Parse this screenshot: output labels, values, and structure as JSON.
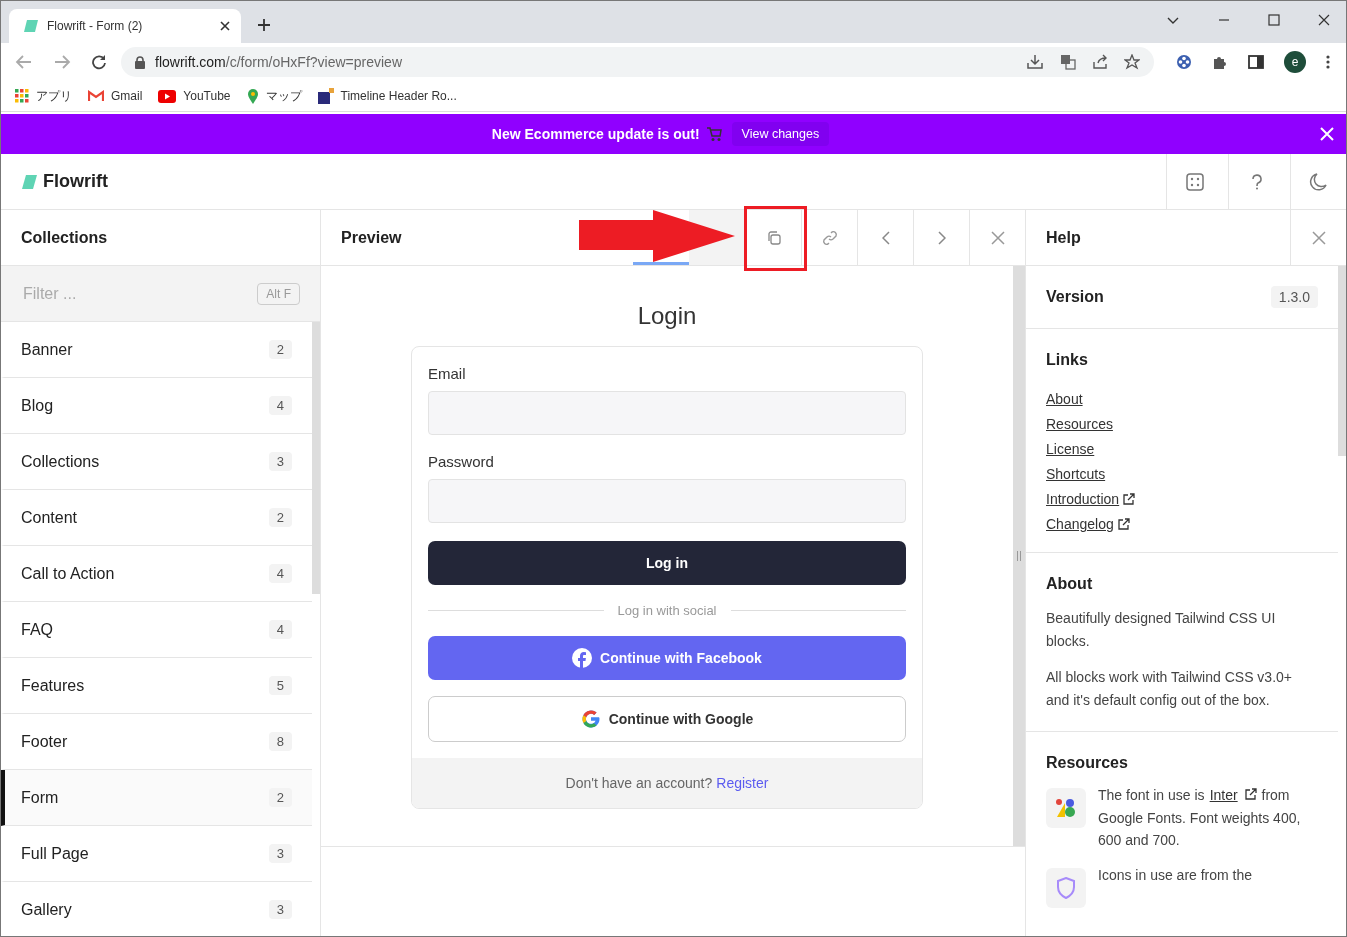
{
  "browser": {
    "tab_title": "Flowrift - Form (2)",
    "url_host": "flowrift.com",
    "url_path": "/c/form/oHxFf?view=preview",
    "avatar": "e",
    "bookmarks": [
      {
        "label": "アプリ",
        "kind": "apps"
      },
      {
        "label": "Gmail",
        "kind": "gmail"
      },
      {
        "label": "YouTube",
        "kind": "youtube"
      },
      {
        "label": "マップ",
        "kind": "maps"
      },
      {
        "label": "Timeline Header Ro...",
        "kind": "grid"
      }
    ]
  },
  "banner": {
    "text": "New Ecommerce update is out!",
    "button": "View changes"
  },
  "app": {
    "name": "Flowrift"
  },
  "sidebar": {
    "title": "Collections",
    "filter_placeholder": "Filter ...",
    "shortcut": "Alt F",
    "items": [
      {
        "label": "Banner",
        "count": "2",
        "selected": false
      },
      {
        "label": "Blog",
        "count": "4",
        "selected": false
      },
      {
        "label": "Collections",
        "count": "3",
        "selected": false
      },
      {
        "label": "Content",
        "count": "2",
        "selected": false
      },
      {
        "label": "Call to Action",
        "count": "4",
        "selected": false
      },
      {
        "label": "FAQ",
        "count": "4",
        "selected": false
      },
      {
        "label": "Features",
        "count": "5",
        "selected": false
      },
      {
        "label": "Footer",
        "count": "8",
        "selected": false
      },
      {
        "label": "Form",
        "count": "2",
        "selected": true
      },
      {
        "label": "Full Page",
        "count": "3",
        "selected": false
      },
      {
        "label": "Gallery",
        "count": "3",
        "selected": false
      }
    ]
  },
  "preview": {
    "title": "Preview",
    "tabs": [
      {
        "selected": true
      },
      {
        "selected": false
      }
    ],
    "form": {
      "title": "Login",
      "email_label": "Email",
      "password_label": "Password",
      "login_button": "Log in",
      "divider": "Log in with social",
      "facebook_button": "Continue with Facebook",
      "google_button": "Continue with Google",
      "footer_text": "Don't have an account?",
      "footer_link": "Register"
    }
  },
  "help": {
    "title": "Help",
    "version_label": "Version",
    "version": "1.3.0",
    "links_title": "Links",
    "links": [
      {
        "label": "About",
        "external": false
      },
      {
        "label": "Resources",
        "external": false
      },
      {
        "label": "License",
        "external": false
      },
      {
        "label": "Shortcuts",
        "external": false
      },
      {
        "label": "Introduction",
        "external": true
      },
      {
        "label": "Changelog",
        "external": true
      }
    ],
    "about_title": "About",
    "about": [
      "Beautifully designed Tailwind CSS UI blocks.",
      "All blocks work with Tailwind CSS v3.0+ and it's default config out of the box."
    ],
    "resources_title": "Resources",
    "resources": [
      {
        "kind": "font",
        "before": "The font in use is",
        "link": "Inter",
        "after": "from Google Fonts. Font weights 400, 600 and 700."
      },
      {
        "kind": "icons",
        "before": "Icons in use are from the"
      }
    ]
  }
}
